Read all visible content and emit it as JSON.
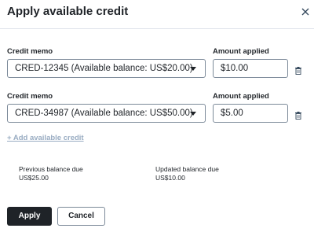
{
  "dialog": {
    "title": "Apply available credit",
    "close_icon": "close-icon"
  },
  "rows": [
    {
      "memo_label": "Credit memo",
      "memo_value": "CRED-12345 (Available balance: US$20.00)",
      "amount_label": "Amount applied",
      "amount_value": "$10.00",
      "delete_icon": "trash-icon"
    },
    {
      "memo_label": "Credit memo",
      "memo_value": "CRED-34987 (Available balance: US$50.00)",
      "amount_label": "Amount applied",
      "amount_value": "$5.00",
      "delete_icon": "trash-icon"
    }
  ],
  "add_credit_label": "+ Add available credit",
  "summary": {
    "previous_label": "Previous balance due",
    "previous_value": "US$25.00",
    "updated_label": "Updated balance due",
    "updated_value": "US$10.00"
  },
  "footer": {
    "apply_label": "Apply",
    "cancel_label": "Cancel"
  },
  "colors": {
    "primary_button": "#1f2328",
    "link_disabled": "#99acc2",
    "border": "#7c8a99"
  }
}
